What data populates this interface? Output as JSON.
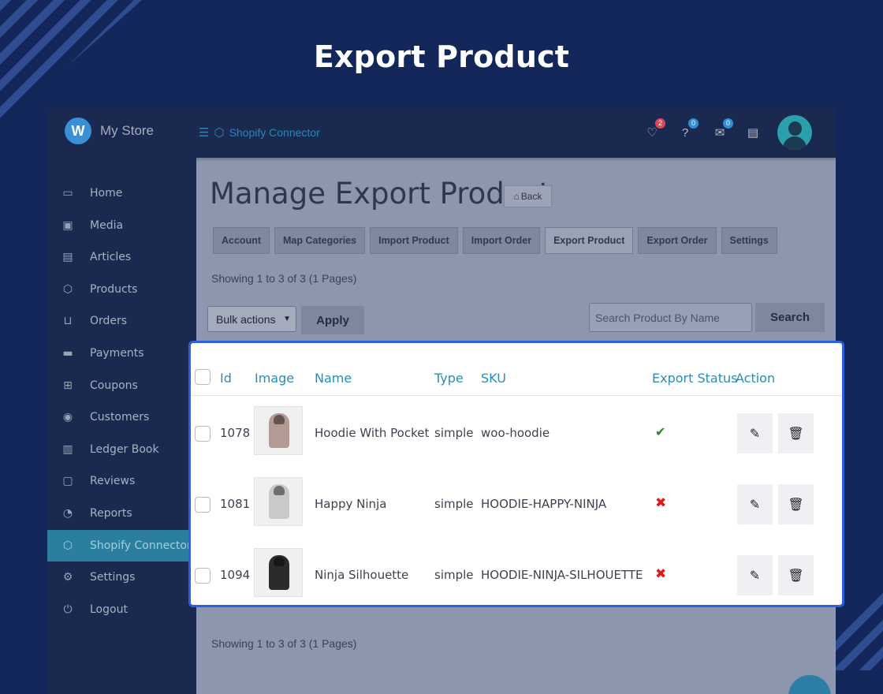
{
  "hero": {
    "title": "Export Product"
  },
  "topbar": {
    "brand_logo": "W",
    "brand_name": "My Store",
    "breadcrumb": "Shopify Connector",
    "notifications_count": "2",
    "help_count": "0",
    "announcements_count": "0"
  },
  "sidebar": {
    "items": [
      {
        "label": "Home",
        "icon": "laptop-icon"
      },
      {
        "label": "Media",
        "icon": "image-icon"
      },
      {
        "label": "Articles",
        "icon": "document-icon"
      },
      {
        "label": "Products",
        "icon": "box-icon"
      },
      {
        "label": "Orders",
        "icon": "cart-icon"
      },
      {
        "label": "Payments",
        "icon": "credit-card-icon"
      },
      {
        "label": "Coupons",
        "icon": "gift-icon"
      },
      {
        "label": "Customers",
        "icon": "user-circle-icon"
      },
      {
        "label": "Ledger Book",
        "icon": "cash-icon"
      },
      {
        "label": "Reviews",
        "icon": "chat-icon"
      },
      {
        "label": "Reports",
        "icon": "pie-chart-icon"
      },
      {
        "label": "Shopify Connector",
        "icon": "box-icon"
      },
      {
        "label": "Settings",
        "icon": "gears-icon"
      },
      {
        "label": "Logout",
        "icon": "power-icon"
      }
    ],
    "active_index": 11
  },
  "main": {
    "title": "Manage Export Product",
    "back_label": "Back",
    "tabs": [
      {
        "label": "Account"
      },
      {
        "label": "Map Categories"
      },
      {
        "label": "Import Product"
      },
      {
        "label": "Import Order"
      },
      {
        "label": "Export Product"
      },
      {
        "label": "Export Order"
      },
      {
        "label": "Settings"
      }
    ],
    "current_tab": 4,
    "showing_top": "Showing 1 to 3 of 3 (1 Pages)",
    "showing_bottom": "Showing 1 to 3 of 3 (1 Pages)",
    "bulk_actions_value": "Bulk actions",
    "apply_label": "Apply",
    "search_placeholder": "Search Product By Name",
    "search_label": "Search"
  },
  "table": {
    "columns": [
      "Id",
      "Image",
      "Name",
      "Type",
      "SKU",
      "Export Status",
      "Action"
    ],
    "rows": [
      {
        "id": "1078",
        "name": "Hoodie With Pocket",
        "type": "simple",
        "sku": "woo-hoodie",
        "status": "✔",
        "hoodie_color": "#b49a95"
      },
      {
        "id": "1081",
        "name": "Happy Ninja",
        "type": "simple",
        "sku": "HOODIE-HAPPY-NINJA",
        "status": "✖",
        "hoodie_color": "#c9c9c9"
      },
      {
        "id": "1094",
        "name": "Ninja Silhouette",
        "type": "simple",
        "sku": "HOODIE-NINJA-SILHOUETTE",
        "status": "✖",
        "hoodie_color": "#2b2b2b"
      }
    ]
  }
}
